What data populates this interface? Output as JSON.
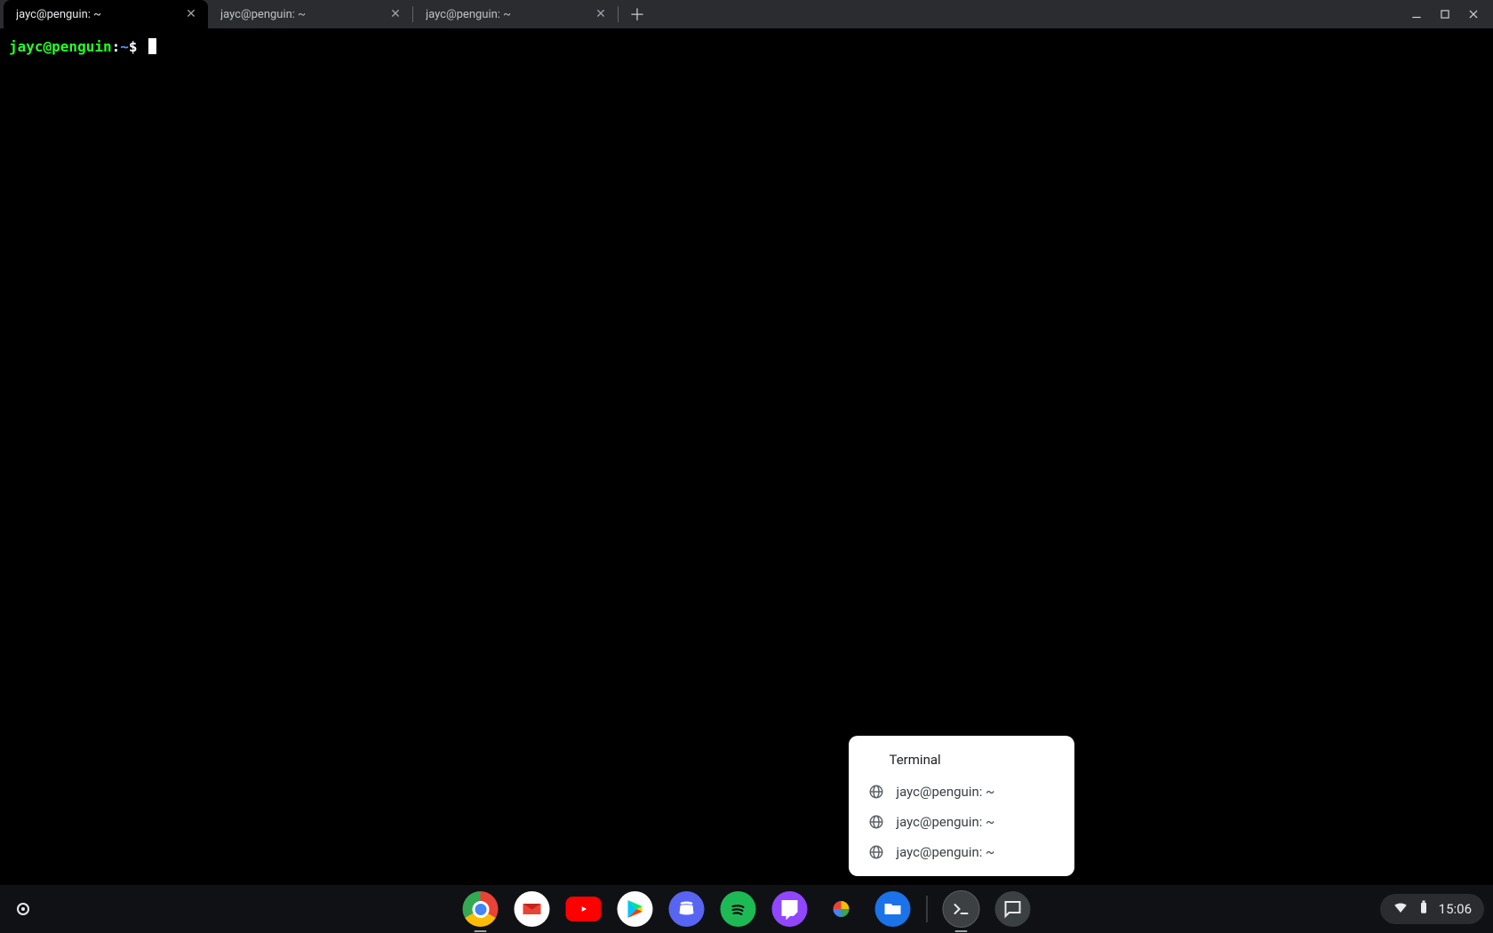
{
  "tabs": [
    {
      "title": "jayc@penguin: ~",
      "active": true
    },
    {
      "title": "jayc@penguin: ~",
      "active": false
    },
    {
      "title": "jayc@penguin: ~",
      "active": false
    }
  ],
  "prompt": {
    "user_host": "jayc@penguin",
    "separator": ":",
    "path": "~",
    "symbol": "$"
  },
  "popup": {
    "title": "Terminal",
    "items": [
      "jayc@penguin: ~",
      "jayc@penguin: ~",
      "jayc@penguin: ~"
    ]
  },
  "systray": {
    "time": "15:06"
  },
  "shelf_apps": [
    {
      "name": "chrome",
      "label": "Google Chrome",
      "running": true
    },
    {
      "name": "gmail",
      "label": "Gmail",
      "running": false
    },
    {
      "name": "youtube",
      "label": "YouTube",
      "running": false
    },
    {
      "name": "play",
      "label": "Play Store",
      "running": false
    },
    {
      "name": "discord",
      "label": "Discord",
      "running": false
    },
    {
      "name": "spotify",
      "label": "Spotify",
      "running": false
    },
    {
      "name": "twitch",
      "label": "Twitch",
      "running": false
    },
    {
      "name": "photos",
      "label": "Google Photos",
      "running": false
    },
    {
      "name": "files",
      "label": "Files",
      "running": false
    },
    {
      "name": "terminal",
      "label": "Terminal",
      "running": true
    },
    {
      "name": "msgs",
      "label": "Messages",
      "running": false
    }
  ]
}
